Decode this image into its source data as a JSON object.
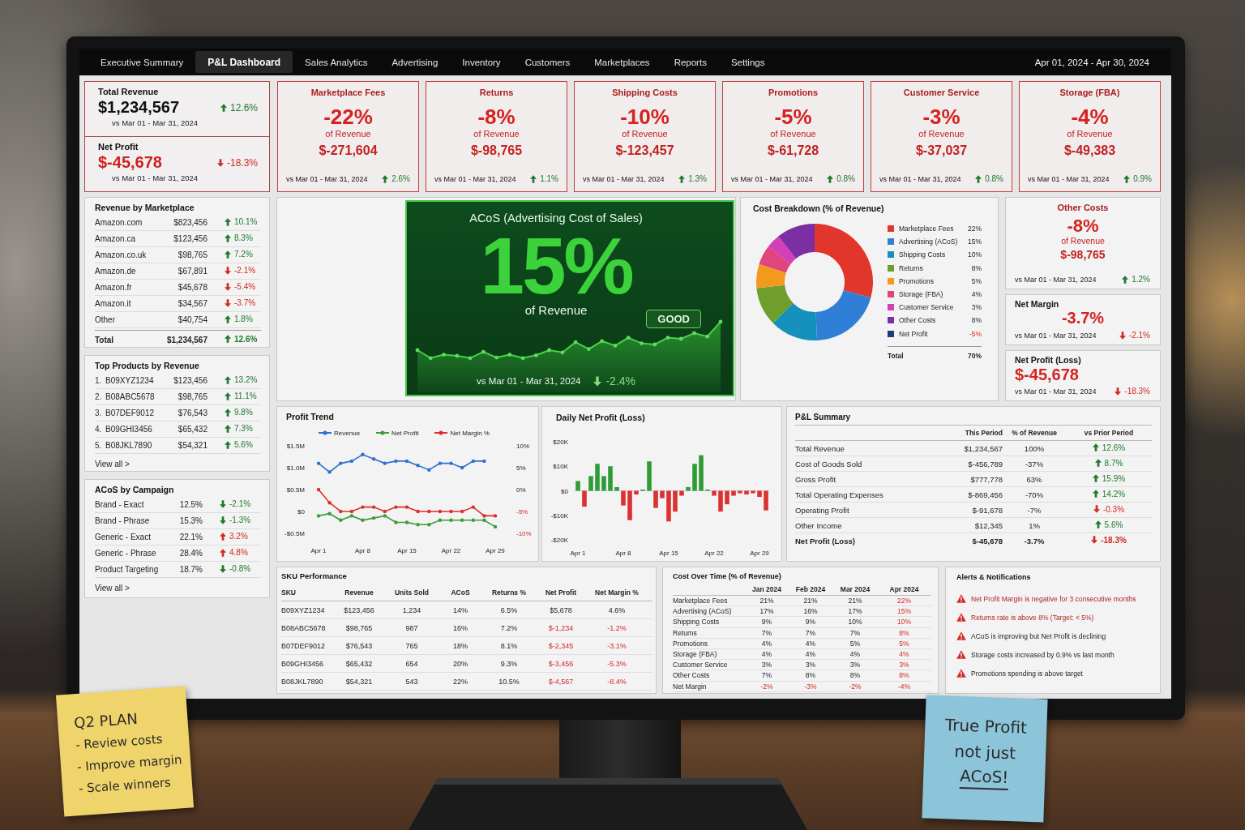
{
  "nav": {
    "tabs": [
      {
        "label": "Executive Summary",
        "selected": false
      },
      {
        "label": "P&L Dashboard",
        "selected": true
      },
      {
        "label": "Sales Analytics",
        "selected": false
      },
      {
        "label": "Advertising",
        "selected": false
      },
      {
        "label": "Inventory",
        "selected": false
      },
      {
        "label": "Customers",
        "selected": false
      },
      {
        "label": "Marketplaces",
        "selected": false
      },
      {
        "label": "Reports",
        "selected": false
      },
      {
        "label": "Settings",
        "selected": false
      }
    ],
    "date_range": "Apr 01, 2024 - Apr 30, 2024"
  },
  "headline": [
    {
      "label": "Total Revenue",
      "value": "$1,234,567",
      "negative": false,
      "change": {
        "text": "12.6%",
        "up": true,
        "good": true
      },
      "period": "vs Mar 01 - Mar 31, 2024"
    },
    {
      "label": "Net Profit",
      "value": "$-45,678",
      "negative": true,
      "change": {
        "text": "-18.3%",
        "up": false,
        "good": false
      },
      "period": "vs Mar 01 - Mar 31, 2024"
    }
  ],
  "cost_cards": [
    {
      "title": "Marketplace Fees",
      "percent": "-22%",
      "caption": "of Revenue",
      "amount": "$-271,604",
      "period": "vs Mar 01 - Mar 31, 2024",
      "change": {
        "text": "2.6%",
        "up": true,
        "good": true
      }
    },
    {
      "title": "Returns",
      "percent": "-8%",
      "caption": "of Revenue",
      "amount": "$-98,765",
      "period": "vs Mar 01 - Mar 31, 2024",
      "change": {
        "text": "1.1%",
        "up": true,
        "good": true
      }
    },
    {
      "title": "Shipping Costs",
      "percent": "-10%",
      "caption": "of Revenue",
      "amount": "$-123,457",
      "period": "vs Mar 01 - Mar 31, 2024",
      "change": {
        "text": "1.3%",
        "up": true,
        "good": true
      }
    },
    {
      "title": "Promotions",
      "percent": "-5%",
      "caption": "of Revenue",
      "amount": "$-61,728",
      "period": "vs Mar 01 - Mar 31, 2024",
      "change": {
        "text": "0.8%",
        "up": true,
        "good": true
      }
    },
    {
      "title": "Customer Service",
      "percent": "-3%",
      "caption": "of Revenue",
      "amount": "$-37,037",
      "period": "vs Mar 01 - Mar 31, 2024",
      "change": {
        "text": "0.8%",
        "up": true,
        "good": true
      }
    },
    {
      "title": "Storage (FBA)",
      "percent": "-4%",
      "caption": "of Revenue",
      "amount": "$-49,383",
      "period": "vs Mar 01 - Mar 31, 2024",
      "change": {
        "text": "0.9%",
        "up": true,
        "good": true
      }
    }
  ],
  "revenue_by_marketplace": {
    "title": "Revenue by Marketplace",
    "rows": [
      {
        "name": "Amazon.com",
        "value": "$823,456",
        "change": {
          "text": "10.1%",
          "up": true,
          "good": true
        }
      },
      {
        "name": "Amazon.ca",
        "value": "$123,456",
        "change": {
          "text": "8.3%",
          "up": true,
          "good": true
        }
      },
      {
        "name": "Amazon.co.uk",
        "value": "$98,765",
        "change": {
          "text": "7.2%",
          "up": true,
          "good": true
        }
      },
      {
        "name": "Amazon.de",
        "value": "$67,891",
        "change": {
          "text": "-2.1%",
          "up": false,
          "good": false
        }
      },
      {
        "name": "Amazon.fr",
        "value": "$45,678",
        "change": {
          "text": "-5.4%",
          "up": false,
          "good": false
        }
      },
      {
        "name": "Amazon.it",
        "value": "$34,567",
        "change": {
          "text": "-3.7%",
          "up": false,
          "good": false
        }
      },
      {
        "name": "Other",
        "value": "$40,754",
        "change": {
          "text": "1.8%",
          "up": true,
          "good": true
        }
      }
    ],
    "total": {
      "label": "Total",
      "value": "$1,234,567",
      "change": {
        "text": "12.6%",
        "up": true,
        "good": true
      }
    }
  },
  "top_products": {
    "title": "Top Products by Revenue",
    "rows": [
      {
        "rank": "1.",
        "sku": "B09XYZ1234",
        "value": "$123,456",
        "change": {
          "text": "13.2%",
          "up": true,
          "good": true
        }
      },
      {
        "rank": "2.",
        "sku": "B08ABC5678",
        "value": "$98,765",
        "change": {
          "text": "11.1%",
          "up": true,
          "good": true
        }
      },
      {
        "rank": "3.",
        "sku": "B07DEF9012",
        "value": "$76,543",
        "change": {
          "text": "9.8%",
          "up": true,
          "good": true
        }
      },
      {
        "rank": "4.",
        "sku": "B09GHI3456",
        "value": "$65,432",
        "change": {
          "text": "7.3%",
          "up": true,
          "good": true
        }
      },
      {
        "rank": "5.",
        "sku": "B08JKL7890",
        "value": "$54,321",
        "change": {
          "text": "5.6%",
          "up": true,
          "good": true
        }
      }
    ],
    "link": "View all >"
  },
  "acos_by_campaign": {
    "title": "ACoS by Campaign",
    "rows": [
      {
        "name": "Brand - Exact",
        "value": "12.5%",
        "change": {
          "text": "-2.1%",
          "up": false,
          "good": true
        }
      },
      {
        "name": "Brand - Phrase",
        "value": "15.3%",
        "change": {
          "text": "-1.3%",
          "up": false,
          "good": true
        }
      },
      {
        "name": "Generic - Exact",
        "value": "22.1%",
        "change": {
          "text": "3.2%",
          "up": true,
          "good": false
        }
      },
      {
        "name": "Generic - Phrase",
        "value": "28.4%",
        "change": {
          "text": "4.8%",
          "up": true,
          "good": false
        }
      },
      {
        "name": "Product Targeting",
        "value": "18.7%",
        "change": {
          "text": "-0.8%",
          "up": false,
          "good": true
        }
      }
    ],
    "link": "View all >"
  },
  "acos_card": {
    "title": "ACoS (Advertising Cost of Sales)",
    "value": "15%",
    "caption": "of Revenue",
    "badge": "GOOD",
    "period": "vs Mar 01 - Mar 31, 2024",
    "change": {
      "text": "-2.4%",
      "up": false,
      "good": true
    }
  },
  "cost_breakdown": {
    "chart_data": {
      "type": "donut",
      "title": "Cost Breakdown (% of Revenue)",
      "categories": [
        "Marketplace Fees",
        "Advertising (ACoS)",
        "Shipping Costs",
        "Returns",
        "Promotions",
        "Storage (FBA)",
        "Customer Service",
        "Other Costs"
      ],
      "values": [
        22,
        15,
        10,
        8,
        5,
        4,
        3,
        8
      ],
      "colors": [
        "#e2362c",
        "#2f7fd6",
        "#1691be",
        "#6f9e2c",
        "#f39a1e",
        "#e2447c",
        "#d43eb6",
        "#7b2fa3"
      ],
      "data_labels": true,
      "value_labels": [
        "22%",
        "15%",
        "10%",
        "8%",
        "5%",
        "4%",
        "3%",
        "8%"
      ],
      "legend": "right"
    },
    "net_row": {
      "label": "Net Profit",
      "value": "-5%",
      "negative": true,
      "color": "#1c3d78"
    },
    "total_label": "Total",
    "total_value": "70%"
  },
  "other_costs": {
    "title": "Other Costs",
    "percent": "-8%",
    "caption": "of Revenue",
    "amount": "$-98,765",
    "period": "vs Mar 01 - Mar 31, 2024",
    "change": {
      "text": "1.2%",
      "up": true,
      "good": true
    }
  },
  "net_margin": {
    "title": "Net Margin",
    "value": "-3.7%",
    "period": "vs Mar 01 - Mar 31, 2024",
    "change": {
      "text": "-2.1%",
      "up": false,
      "good": false
    }
  },
  "net_profit": {
    "title": "Net Profit (Loss)",
    "value": "$-45,678",
    "period": "vs Mar 01 - Mar 31, 2024",
    "change": {
      "text": "-18.3%",
      "up": false,
      "good": false
    }
  },
  "profit_trend": {
    "chart_data": {
      "type": "line",
      "title": "Profit Trend",
      "legend": "top",
      "categories": [
        "Apr 1",
        null,
        null,
        null,
        "Apr 8",
        null,
        null,
        null,
        "Apr 15",
        null,
        null,
        null,
        "Apr 22",
        null,
        null,
        null,
        "Apr 29"
      ],
      "series": [
        {
          "name": "Revenue",
          "color": "#2f6fd1",
          "values": [
            1100000,
            900000,
            1100000,
            1150000,
            1300000,
            1200000,
            1100000,
            1150000,
            1150000,
            1050000,
            950000,
            1100000,
            1100000,
            1000000,
            1150000,
            1150000,
            null
          ]
        },
        {
          "name": "Net Profit",
          "color": "#3a9d3a",
          "values": [
            -100000,
            -50000,
            -200000,
            -100000,
            -200000,
            -150000,
            -100000,
            -250000,
            -250000,
            -300000,
            -300000,
            -200000,
            -200000,
            -200000,
            -200000,
            -200000,
            -350000
          ]
        },
        {
          "name": "Net Margin %",
          "color": "#d9302c",
          "axis": "y2",
          "values": [
            0,
            -3,
            -5,
            -5,
            -4,
            -4,
            -5,
            -4,
            -4,
            -5,
            -5,
            -5,
            -5,
            -5,
            -4,
            -6,
            -6
          ]
        }
      ],
      "ylim": [
        -500000,
        1500000
      ],
      "yticks": [
        {
          "value": 1500000,
          "label": "$1.5M"
        },
        {
          "value": 1000000,
          "label": "$1.0M"
        },
        {
          "value": 500000,
          "label": "$0.5M"
        },
        {
          "value": 0,
          "label": "$0"
        },
        {
          "value": -500000,
          "label": "-$0.5M"
        }
      ],
      "y2lim": [
        -10,
        10
      ],
      "y2ticks": [
        {
          "value": 10,
          "label": "10%"
        },
        {
          "value": 5,
          "label": "5%"
        },
        {
          "value": 0,
          "label": "0%"
        },
        {
          "value": -5,
          "label": "-5%"
        },
        {
          "value": -10,
          "label": "-10%"
        }
      ]
    }
  },
  "daily_net_profit": {
    "chart_data": {
      "type": "bar",
      "title": "Daily Net Profit (Loss)",
      "categories": [
        "Apr 1",
        null,
        null,
        null,
        null,
        null,
        null,
        "Apr 8",
        null,
        null,
        null,
        null,
        null,
        null,
        "Apr 15",
        null,
        null,
        null,
        null,
        null,
        null,
        "Apr 22",
        null,
        null,
        null,
        null,
        null,
        null,
        "Apr 29",
        null
      ],
      "series": [
        {
          "values": [
            4000,
            -6500,
            6000,
            11000,
            6000,
            10000,
            1500,
            -6000,
            -12000,
            -1500,
            500,
            12000,
            -7000,
            -3000,
            -12500,
            -8500,
            -2000,
            1500,
            11000,
            14500,
            500,
            -2000,
            -8500,
            -5500,
            -2000,
            -1000,
            -1500,
            -1000,
            -2500,
            -8000
          ]
        }
      ],
      "ylim": [
        -20000,
        20000
      ],
      "yticks": [
        {
          "value": 20000,
          "label": "$20K"
        },
        {
          "value": 10000,
          "label": "$10K"
        },
        {
          "value": 0,
          "label": "$0"
        },
        {
          "value": -10000,
          "label": "-$10K"
        },
        {
          "value": -20000,
          "label": "-$20K"
        }
      ]
    }
  },
  "pl_summary": {
    "title": "P&L Summary",
    "columns": [
      "This Period",
      "% of Revenue",
      "vs Prior Period"
    ],
    "rows": [
      {
        "label": "Total Revenue",
        "value": "$1,234,567",
        "share": "100%",
        "change": {
          "text": "12.6%",
          "up": true,
          "good": true
        },
        "emphasis": false
      },
      {
        "label": "Cost of Goods Sold",
        "value": "$-456,789",
        "share": "-37%",
        "change": {
          "text": "8.7%",
          "up": true,
          "good": true
        },
        "emphasis": false
      },
      {
        "label": "Gross Profit",
        "value": "$777,778",
        "share": "63%",
        "change": {
          "text": "15.9%",
          "up": true,
          "good": true
        },
        "emphasis": false
      },
      {
        "label": "Total Operating Expenses",
        "value": "$-869,456",
        "share": "-70%",
        "change": {
          "text": "14.2%",
          "up": true,
          "good": true
        },
        "emphasis": false
      },
      {
        "label": "Operating Profit",
        "value": "$-91,678",
        "share": "-7%",
        "change": {
          "text": "-0.3%",
          "up": false,
          "good": false
        },
        "emphasis": false
      },
      {
        "label": "Other Income",
        "value": "$12,345",
        "share": "1%",
        "change": {
          "text": "5.6%",
          "up": true,
          "good": true
        },
        "emphasis": false
      },
      {
        "label": "Net Profit (Loss)",
        "value": "$-45,678",
        "share": "-3.7%",
        "change": {
          "text": "-18.3%",
          "up": false,
          "good": false
        },
        "emphasis": true
      }
    ]
  },
  "sku_performance": {
    "title": "SKU Performance",
    "columns": [
      "SKU",
      "Revenue",
      "Units Sold",
      "ACoS",
      "Returns %",
      "Net Profit",
      "Net Margin %"
    ],
    "rows": [
      {
        "cells": [
          "B09XYZ1234",
          "$123,456",
          "1,234",
          "14%",
          "6.5%",
          "$5,678",
          "4.6%"
        ],
        "loss": false
      },
      {
        "cells": [
          "B08ABC5678",
          "$98,765",
          "987",
          "16%",
          "7.2%",
          "$-1,234",
          "-1.2%"
        ],
        "loss": true
      },
      {
        "cells": [
          "B07DEF9012",
          "$76,543",
          "765",
          "18%",
          "8.1%",
          "$-2,345",
          "-3.1%"
        ],
        "loss": true
      },
      {
        "cells": [
          "B09GHI3456",
          "$65,432",
          "654",
          "20%",
          "9.3%",
          "$-3,456",
          "-5.3%"
        ],
        "loss": true
      },
      {
        "cells": [
          "B08JKL7890",
          "$54,321",
          "543",
          "22%",
          "10.5%",
          "$-4,567",
          "-8.4%"
        ],
        "loss": true
      }
    ]
  },
  "cost_over_time": {
    "title": "Cost Over Time (% of Revenue)",
    "columns": [
      {
        "label": "Jan 2024",
        "highlight": false
      },
      {
        "label": "Feb 2024",
        "highlight": false
      },
      {
        "label": "Mar 2024",
        "highlight": false
      },
      {
        "label": "Apr 2024",
        "highlight": true
      }
    ],
    "rows": [
      {
        "label": "Marketplace Fees",
        "values": [
          "21%",
          "21%",
          "21%",
          "22%"
        ],
        "highlight": false
      },
      {
        "label": "Advertising (ACoS)",
        "values": [
          "17%",
          "16%",
          "17%",
          "15%"
        ],
        "highlight": false
      },
      {
        "label": "Shipping Costs",
        "values": [
          "9%",
          "9%",
          "10%",
          "10%"
        ],
        "highlight": false
      },
      {
        "label": "Returns",
        "values": [
          "7%",
          "7%",
          "7%",
          "8%"
        ],
        "highlight": false
      },
      {
        "label": "Promotions",
        "values": [
          "4%",
          "4%",
          "5%",
          "5%"
        ],
        "highlight": false
      },
      {
        "label": "Storage (FBA)",
        "values": [
          "4%",
          "4%",
          "4%",
          "4%"
        ],
        "highlight": false
      },
      {
        "label": "Customer Service",
        "values": [
          "3%",
          "3%",
          "3%",
          "3%"
        ],
        "highlight": false
      },
      {
        "label": "Other Costs",
        "values": [
          "7%",
          "8%",
          "8%",
          "8%"
        ],
        "highlight": false
      },
      {
        "label": "Net Margin",
        "values": [
          "-2%",
          "-3%",
          "-2%",
          "-4%"
        ],
        "highlight": true
      }
    ]
  },
  "alerts": {
    "title": "Alerts & Notifications",
    "items": [
      {
        "text": "Net Profit Margin is negative for 3 consecutive months",
        "urgent": true
      },
      {
        "text": "Returns rate is above 8% (Target: < 5%)",
        "urgent": true
      },
      {
        "text": "ACoS is improving but Net Profit is declining",
        "urgent": false
      },
      {
        "text": "Storage costs increased by 0.9% vs last month",
        "urgent": false
      },
      {
        "text": "Promotions spending is above target",
        "urgent": false
      }
    ]
  },
  "sticky_notes": [
    {
      "color": "#efd46c",
      "lines": [
        {
          "text": "Q2 PLAN",
          "underlined": false
        },
        {
          "text": "- Review costs",
          "underlined": false
        },
        {
          "text": "- Improve margin",
          "underlined": false
        },
        {
          "text": "- Scale winners",
          "underlined": false
        }
      ]
    },
    {
      "color": "#8cc4d9",
      "lines": [
        {
          "text": "True Profit",
          "underlined": false
        },
        {
          "text": "not just",
          "underlined": false
        },
        {
          "text": "ACoS!",
          "underlined": true
        }
      ]
    }
  ]
}
